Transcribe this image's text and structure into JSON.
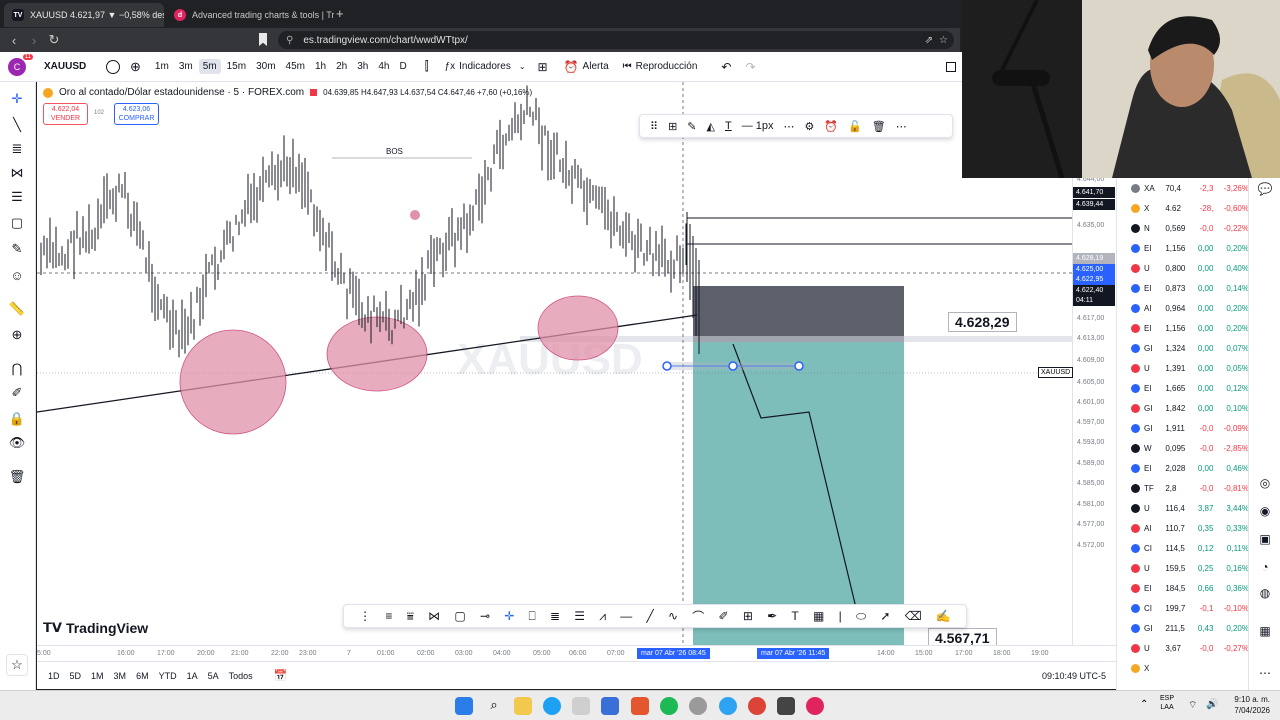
{
  "browser": {
    "tabs": [
      {
        "title": "XAUUSD 4.621,97 ▼ −0,58% des",
        "active": true
      },
      {
        "title": "Advanced trading charts & tools | Tr",
        "active": false
      }
    ],
    "url": "es.tradingview.com/chart/wwdWTtpx/"
  },
  "toolbar": {
    "avatar_letter": "C",
    "avatar_badge": "11",
    "symbol": "XAUUSD",
    "timeframes": [
      "1m",
      "3m",
      "5m",
      "15m",
      "30m",
      "45m",
      "1h",
      "2h",
      "3h",
      "4h",
      "D"
    ],
    "selected_timeframe": "5m",
    "indicators_label": "Indicadores",
    "alert_label": "Alerta",
    "replay_label": "Reproducción"
  },
  "chart_header": {
    "symbol_desc": "Oro al contado/Dólar estadounidense · 5 · FOREX.com",
    "ohlc": "04.639,85  H4.647,93  L4.637,54  C4.647,46  +7,60 (+0,16%)",
    "sell_price": "4.622,04",
    "sell_label": "VENDER",
    "spread": "102",
    "buy_price": "4.623,06",
    "buy_label": "COMPRAR"
  },
  "annotations": {
    "bos_label": "BOS",
    "watermark": "XAUUSD",
    "entry_tag": "4.628,29",
    "target_tag": "4.567,71"
  },
  "price_axis": {
    "labels": [
      "4.656,00",
      "4.652,28",
      "4.647,26",
      "4.644,00",
      "4.641,70",
      "4.639,44",
      "4.635,00",
      "4.628,19",
      "4.625,00",
      "4.622,95",
      "4.622,40",
      "04:11",
      "4.617,00",
      "4.613,00",
      "4.609,00",
      "4.605,00",
      "4.601,00",
      "4.597,00",
      "4.593,00",
      "4.589,00",
      "4.585,00",
      "4.581,00",
      "4.577,00",
      "4.572,00"
    ],
    "symbol_tag": "XAUUSD"
  },
  "time_axis": {
    "labels": [
      "5:00",
      "16:00",
      "17:00",
      "20:00",
      "21:00",
      "22:00",
      "23:00",
      "7",
      "01:00",
      "02:00",
      "03:00",
      "04:00",
      "05:00",
      "06:00",
      "07:00",
      "mar 07 Abr '26  08:45",
      "mar 07 Abr '26  11:45",
      "14:00",
      "15:00",
      "17:00",
      "18:00",
      "19:00"
    ]
  },
  "bottom_bar": {
    "ranges": [
      "1D",
      "5D",
      "1M",
      "3M",
      "6M",
      "YTD",
      "1A",
      "5A",
      "Todos"
    ],
    "clock": "09:10:49 UTC-5"
  },
  "tradingview_logo": "TradingView",
  "watchlist": [
    {
      "sym": "XA",
      "price": "70,4",
      "chg": "-2,3",
      "pct": "-3,26%",
      "color": "#787b86"
    },
    {
      "sym": "X",
      "price": "4.62",
      "chg": "-28,",
      "pct": "-0,60%",
      "color": "#f5a623"
    },
    {
      "sym": "N",
      "price": "0,569",
      "chg": "-0,0",
      "pct": "-0,22%",
      "color": "#131722"
    },
    {
      "sym": "EI",
      "price": "1,156",
      "chg": "0,00",
      "pct": "0,20%",
      "color": "#2962ff"
    },
    {
      "sym": "U",
      "price": "0,800",
      "chg": "0,00",
      "pct": "0,40%",
      "color": "#f23645"
    },
    {
      "sym": "EI",
      "price": "0,873",
      "chg": "0,00",
      "pct": "0,14%",
      "color": "#2962ff"
    },
    {
      "sym": "AI",
      "price": "0,964",
      "chg": "0,00",
      "pct": "0,20%",
      "color": "#2962ff"
    },
    {
      "sym": "EI",
      "price": "1,156",
      "chg": "0,00",
      "pct": "0,20%",
      "color": "#f23645"
    },
    {
      "sym": "GI",
      "price": "1,324",
      "chg": "0,00",
      "pct": "0,07%",
      "color": "#2962ff"
    },
    {
      "sym": "U",
      "price": "1,391",
      "chg": "0,00",
      "pct": "0,05%",
      "color": "#f23645"
    },
    {
      "sym": "EI",
      "price": "1,665",
      "chg": "0,00",
      "pct": "0,12%",
      "color": "#2962ff"
    },
    {
      "sym": "GI",
      "price": "1,842",
      "chg": "0,00",
      "pct": "0,10%",
      "color": "#f23645"
    },
    {
      "sym": "GI",
      "price": "1,911",
      "chg": "-0,0",
      "pct": "-0,09%",
      "color": "#2962ff"
    },
    {
      "sym": "W",
      "price": "0,095",
      "chg": "-0,0",
      "pct": "-2,85%",
      "color": "#131722"
    },
    {
      "sym": "EI",
      "price": "2,028",
      "chg": "0,00",
      "pct": "0,46%",
      "color": "#2962ff"
    },
    {
      "sym": "TF",
      "price": "2,8",
      "chg": "-0,0",
      "pct": "-0,81%",
      "color": "#131722"
    },
    {
      "sym": "U",
      "price": "116,4",
      "chg": "3,87",
      "pct": "3,44%",
      "color": "#131722"
    },
    {
      "sym": "AI",
      "price": "110,7",
      "chg": "0,35",
      "pct": "0,33%",
      "color": "#f23645"
    },
    {
      "sym": "CI",
      "price": "114,5",
      "chg": "0,12",
      "pct": "0,11%",
      "color": "#2962ff"
    },
    {
      "sym": "U",
      "price": "159,5",
      "chg": "0,25",
      "pct": "0,16%",
      "color": "#f23645"
    },
    {
      "sym": "EI",
      "price": "184,5",
      "chg": "0,66",
      "pct": "0,36%",
      "color": "#f23645"
    },
    {
      "sym": "CI",
      "price": "199,7",
      "chg": "-0,1",
      "pct": "-0,10%",
      "color": "#2962ff"
    },
    {
      "sym": "GI",
      "price": "211,5",
      "chg": "0,43",
      "pct": "0,20%",
      "color": "#2962ff"
    },
    {
      "sym": "U",
      "price": "3,67",
      "chg": "-0,0",
      "pct": "-0,27%",
      "color": "#f23645"
    },
    {
      "sym": "X",
      "price": "",
      "chg": "",
      "pct": "",
      "color": "#f5a623"
    }
  ],
  "taskbar": {
    "lang": "ESP\nLAA",
    "time": "9:10 a. m.",
    "date": "7/04/2026"
  }
}
